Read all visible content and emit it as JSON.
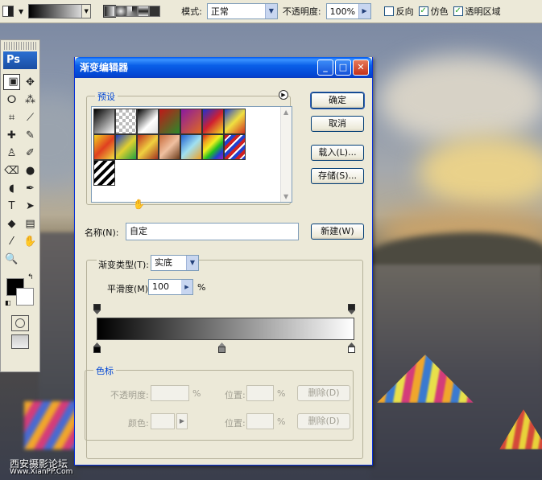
{
  "options_bar": {
    "mode_label": "模式:",
    "mode_value": "正常",
    "opacity_label": "不透明度:",
    "opacity_value": "100%",
    "reverse_label": "反向",
    "reverse_checked": false,
    "dither_label": "仿色",
    "dither_checked": true,
    "transparency_label": "透明区域",
    "transparency_checked": true
  },
  "toolbox": {
    "logo": "Ps",
    "tools": [
      "marquee-icon",
      "move-icon",
      "lasso-icon",
      "magic-wand-icon",
      "crop-icon",
      "slice-icon",
      "healing-icon",
      "brush-icon",
      "stamp-icon",
      "history-brush-icon",
      "eraser-icon",
      "gradient-icon",
      "blur-icon",
      "dodge-icon",
      "pen-icon",
      "type-icon",
      "path-select-icon",
      "shape-icon",
      "notes-icon",
      "eyedropper-icon",
      "hand-icon",
      "zoom-icon"
    ],
    "tool_glyphs": [
      "⬚",
      "✥",
      "ⵔ",
      "⁂",
      "⌗",
      "⟋",
      "✚",
      "✎",
      "♙",
      "✐",
      "⌫",
      "▣",
      "●",
      "◖",
      "✒",
      "T",
      "➤",
      "◆",
      "▤",
      "⁄",
      "✋",
      "🔍"
    ],
    "foreground_color": "#000000",
    "background_color": "#ffffff"
  },
  "dialog": {
    "title": "渐变编辑器",
    "presets_label": "预设",
    "ok": "确定",
    "cancel": "取消",
    "load": "载入(L)...",
    "save": "存储(S)...",
    "name_label": "名称(N):",
    "name_value": "自定",
    "new_button": "新建(W)",
    "gradient_type_label": "渐变类型(T):",
    "gradient_type_value": "实底",
    "smoothness_label": "平滑度(M):",
    "smoothness_value": "100",
    "smoothness_unit": "%",
    "stops_label": "色标",
    "opacity_label": "不透明度:",
    "opacity_unit": "%",
    "location_label": "位置:",
    "location_unit": "%",
    "delete_label": "删除(D)",
    "color_label": "颜色:",
    "location_label_2": "位置:",
    "location_unit_2": "%",
    "delete_label_2": "删除(D)",
    "presets": [
      "linear-gradient(135deg,#000,#fff)",
      "repeating-conic-gradient(#bbb 0 25%,#fff 0 50%) 0 0/8px 8px",
      "linear-gradient(135deg,#000,#fff 60%,#ddd)",
      "linear-gradient(135deg,#c01818,#2a8a2a)",
      "linear-gradient(135deg,#8a1aa0,#e06a20)",
      "linear-gradient(135deg,#2030d0,#d02030,#f0e020)",
      "linear-gradient(135deg,#2040d0,#f0e040,#d03020)",
      "linear-gradient(135deg,#f0d020,#e04020,#f0e040)",
      "linear-gradient(135deg,#2040c0,#e0d030,#20a040)",
      "linear-gradient(135deg,#c03020,#f0d040,#a03020)",
      "linear-gradient(135deg,#c86a3a,#f0c0a0,#6a3a1a)",
      "linear-gradient(135deg,#2060d0,#a0e0f0,#f0a020)",
      "linear-gradient(135deg,#d02020,#f0a020,#f0f020,#20c020,#2040d0,#a020c0)",
      "repeating-linear-gradient(135deg,#d02020 0 4px,#fff 4px 6px,#2040d0 6px 10px)",
      "repeating-linear-gradient(135deg,#000 0 4px,#fff 4px 8px)"
    ]
  }
}
